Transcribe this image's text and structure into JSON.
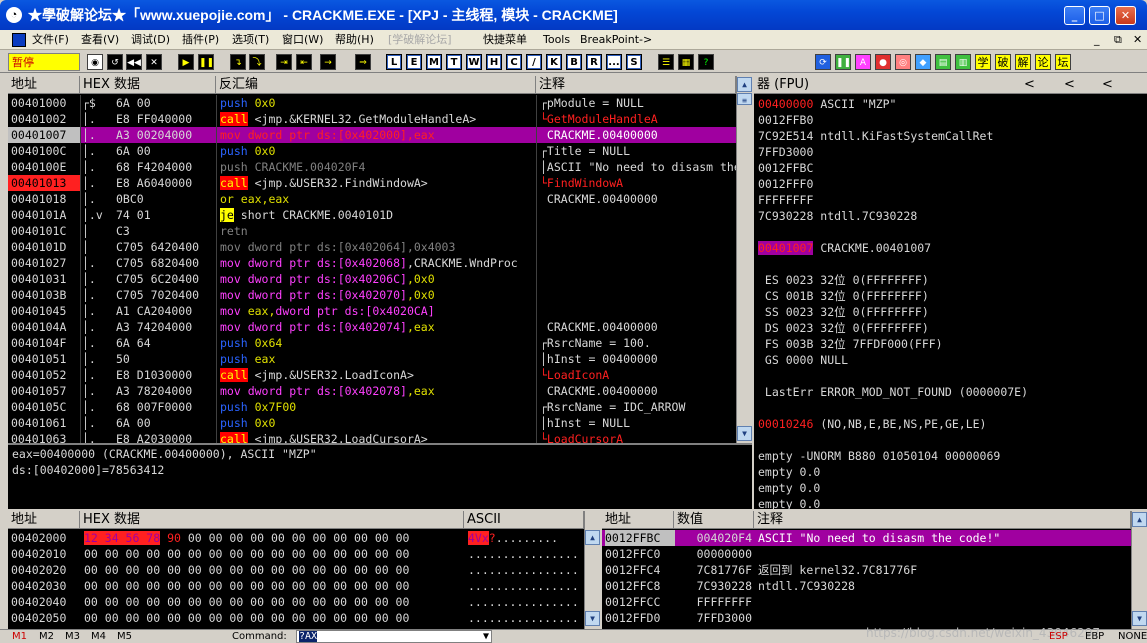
{
  "window": {
    "title": "★學破解论坛★「www.xuepojie.com」 - CRACKME.EXE - [XPJ - 主线程, 模块 - CRACKME]",
    "min": "_",
    "max": "□",
    "close": "✕"
  },
  "menu": {
    "items": [
      "文件(F)",
      "查看(V)",
      "调试(D)",
      "插件(P)",
      "选项(T)",
      "窗口(W)",
      "帮助(H)",
      "[学破解论坛]",
      "快捷菜单",
      "Tools",
      "BreakPoint->"
    ],
    "mdi": [
      "_",
      "⧉",
      "✕"
    ]
  },
  "toolbar": {
    "status": "暂停",
    "letters": [
      "L",
      "E",
      "M",
      "T",
      "W",
      "H",
      "C",
      "/",
      "K",
      "B",
      "R",
      "...",
      "S"
    ],
    "chinese": [
      "学",
      "破",
      "解",
      "论",
      "坛"
    ]
  },
  "disasm": {
    "headers": {
      "addr": "地址",
      "hex": "HEX 数据",
      "dis": "反汇编",
      "comment": "注释"
    },
    "rows": [
      {
        "addr": "00401000",
        "mark": "┌$",
        "hex": "6A 00",
        "dis": [
          [
            "push",
            "kw-push"
          ],
          [
            " 0x0",
            "y"
          ]
        ],
        "comment": "┌pModule = NULL",
        "cclass": "w"
      },
      {
        "addr": "00401002",
        "mark": "│.",
        "hex": "E8 FF040000",
        "dis": [
          [
            "call",
            "kw-call"
          ],
          [
            " <jmp.&KERNEL32.GetModuleHandleA>",
            "w"
          ]
        ],
        "comment": "└GetModuleHandleA",
        "cclass": "red"
      },
      {
        "addr": "00401007",
        "mark": "│.",
        "hex": "A3 00204000",
        "dis": [
          [
            "mov dword ptr ds:[0x402000],eax",
            "red"
          ]
        ],
        "comment": " CRACKME.00400000",
        "cclass": "w",
        "sel": true
      },
      {
        "addr": "0040100C",
        "mark": "│.",
        "hex": "6A 00",
        "dis": [
          [
            "push",
            "kw-push"
          ],
          [
            " 0x0",
            "y"
          ]
        ],
        "comment": "┌Title = NULL",
        "cclass": "w"
      },
      {
        "addr": "0040100E",
        "mark": "│.",
        "hex": "68 F4204000",
        "dis": [
          [
            "push CRACKME.004020F4",
            "gray"
          ]
        ],
        "comment": "│ASCII \"No need to disasm the code!\"",
        "cclass": "w"
      },
      {
        "addr": "00401013",
        "mark": "│.",
        "hex": "E8 A6040000",
        "dis": [
          [
            "call",
            "kw-call"
          ],
          [
            " <jmp.&USER32.FindWindowA>",
            "w"
          ]
        ],
        "comment": "└FindWindowA",
        "cclass": "red",
        "addrRed": true
      },
      {
        "addr": "00401018",
        "mark": "│.",
        "hex": "0BC0",
        "dis": [
          [
            "or eax,eax",
            "y"
          ]
        ],
        "comment": " CRACKME.00400000",
        "cclass": "w"
      },
      {
        "addr": "0040101A",
        "mark": "│.v",
        "hex": "74 01",
        "dis": [
          [
            "je",
            "kw-je"
          ],
          [
            " short CRACKME.0040101D",
            "w"
          ]
        ],
        "comment": "",
        "cclass": "w"
      },
      {
        "addr": "0040101C",
        "mark": "│",
        "hex": "C3",
        "dis": [
          [
            "retn",
            "gray"
          ]
        ],
        "comment": "",
        "cclass": "w"
      },
      {
        "addr": "0040101D",
        "mark": "│",
        "hex": "C705 6420400",
        "dis": [
          [
            "mov dword ptr ds:[0x402064],0x4003",
            "gray"
          ]
        ],
        "comment": "",
        "cclass": "w"
      },
      {
        "addr": "00401027",
        "mark": "│.",
        "hex": "C705 6820400",
        "dis": [
          [
            "mov",
            "kw-mov"
          ],
          [
            " dword ptr ds:[0x402068]",
            "mag"
          ],
          [
            ",CRACKME.WndProc",
            "w"
          ]
        ],
        "comment": "",
        "cclass": "w"
      },
      {
        "addr": "00401031",
        "mark": "│.",
        "hex": "C705 6C20400",
        "dis": [
          [
            "mov",
            "kw-mov"
          ],
          [
            " dword ptr ds:[0x40206C]",
            "mag"
          ],
          [
            ",0x0",
            "y"
          ]
        ],
        "comment": "",
        "cclass": "w"
      },
      {
        "addr": "0040103B",
        "mark": "│.",
        "hex": "C705 7020400",
        "dis": [
          [
            "mov",
            "kw-mov"
          ],
          [
            " dword ptr ds:[0x402070]",
            "mag"
          ],
          [
            ",0x0",
            "y"
          ]
        ],
        "comment": "",
        "cclass": "w"
      },
      {
        "addr": "00401045",
        "mark": "│.",
        "hex": "A1 CA204000",
        "dis": [
          [
            "mov",
            "kw-mov"
          ],
          [
            " eax,",
            "y"
          ],
          [
            "dword ptr ds:[0x4020CA]",
            "mag"
          ]
        ],
        "comment": "",
        "cclass": "w"
      },
      {
        "addr": "0040104A",
        "mark": "│.",
        "hex": "A3 74204000",
        "dis": [
          [
            "mov",
            "kw-mov"
          ],
          [
            " dword ptr ds:[0x402074]",
            "mag"
          ],
          [
            ",eax",
            "y"
          ]
        ],
        "comment": " CRACKME.00400000",
        "cclass": "w"
      },
      {
        "addr": "0040104F",
        "mark": "│.",
        "hex": "6A 64",
        "dis": [
          [
            "push",
            "kw-push"
          ],
          [
            " 0x64",
            "y"
          ]
        ],
        "comment": "┌RsrcName = 100.",
        "cclass": "w"
      },
      {
        "addr": "00401051",
        "mark": "│.",
        "hex": "50",
        "dis": [
          [
            "push",
            "kw-push"
          ],
          [
            " eax",
            "y"
          ]
        ],
        "comment": "│hInst = 00400000",
        "cclass": "w"
      },
      {
        "addr": "00401052",
        "mark": "│.",
        "hex": "E8 D1030000",
        "dis": [
          [
            "call",
            "kw-call"
          ],
          [
            " <jmp.&USER32.LoadIconA>",
            "w"
          ]
        ],
        "comment": "└LoadIconA",
        "cclass": "red"
      },
      {
        "addr": "00401057",
        "mark": "│.",
        "hex": "A3 78204000",
        "dis": [
          [
            "mov",
            "kw-mov"
          ],
          [
            " dword ptr ds:[0x402078]",
            "mag"
          ],
          [
            ",eax",
            "y"
          ]
        ],
        "comment": " CRACKME.00400000",
        "cclass": "w"
      },
      {
        "addr": "0040105C",
        "mark": "│.",
        "hex": "68 007F0000",
        "dis": [
          [
            "push",
            "kw-push"
          ],
          [
            " 0x7F00",
            "y"
          ]
        ],
        "comment": "┌RsrcName = IDC_ARROW",
        "cclass": "w"
      },
      {
        "addr": "00401061",
        "mark": "│.",
        "hex": "6A 00",
        "dis": [
          [
            "push",
            "kw-push"
          ],
          [
            " 0x0",
            "y"
          ]
        ],
        "comment": "│hInst = NULL",
        "cclass": "w"
      },
      {
        "addr": "00401063",
        "mark": "│.",
        "hex": "E8 A2030000",
        "dis": [
          [
            "call",
            "kw-call"
          ],
          [
            " <jmp.&USER32.LoadCursorA>",
            "w"
          ]
        ],
        "comment": "└LoadCursorA",
        "cclass": "red"
      }
    ],
    "info": [
      "eax=00400000 (CRACKME.00400000), ASCII \"MZP\"",
      "ds:[00402000]=78563412"
    ]
  },
  "registers": {
    "header": "器 (FPU)",
    "arrows": [
      "<",
      "<",
      "<"
    ],
    "lines": [
      {
        "t": "00400000 ASCII \"MZP\"",
        "c": "reghl"
      },
      {
        "t": "0012FFB0",
        "c": "w"
      },
      {
        "t": "7C92E514 ntdll.KiFastSystemCallRet",
        "c": "w"
      },
      {
        "t": "7FFD3000",
        "c": "w"
      },
      {
        "t": "0012FFBC",
        "c": "w"
      },
      {
        "t": "0012FFF0",
        "c": "w"
      },
      {
        "t": "FFFFFFFF",
        "c": "w"
      },
      {
        "t": "7C930228 ntdll.7C930228",
        "c": "w"
      },
      {
        "t": "",
        "c": "w"
      },
      {
        "t": "00401007 CRACKME.00401007",
        "c": "eip"
      },
      {
        "t": "",
        "c": "w"
      },
      {
        "t": " ES 0023 32位 0(FFFFFFFF)",
        "c": "w"
      },
      {
        "t": " CS 001B 32位 0(FFFFFFFF)",
        "c": "w"
      },
      {
        "t": " SS 0023 32位 0(FFFFFFFF)",
        "c": "w"
      },
      {
        "t": " DS 0023 32位 0(FFFFFFFF)",
        "c": "w"
      },
      {
        "t": " FS 003B 32位 7FFDF000(FFF)",
        "c": "w"
      },
      {
        "t": " GS 0000 NULL",
        "c": "w"
      },
      {
        "t": "",
        "c": "w"
      },
      {
        "t": " LastErr ERROR_MOD_NOT_FOUND (0000007E)",
        "c": "w"
      },
      {
        "t": "",
        "c": "w"
      },
      {
        "t": "00010246 (NO,NB,E,BE,NS,PE,GE,LE)",
        "c": "efl"
      },
      {
        "t": "",
        "c": "w"
      },
      {
        "t": "empty -UNORM B880 01050104 00000069",
        "c": "w"
      },
      {
        "t": "empty 0.0",
        "c": "w"
      },
      {
        "t": "empty 0.0",
        "c": "w"
      },
      {
        "t": "empty 0.0",
        "c": "w"
      },
      {
        "t": "empty 0.0",
        "c": "w"
      },
      {
        "t": "empty 0.0",
        "c": "w"
      }
    ]
  },
  "dump": {
    "headers": {
      "addr": "地址",
      "hex": "HEX 数据",
      "ascii": "ASCII"
    },
    "rows": [
      {
        "addr": "00402000",
        "hex": "12 34 56 78 90 00 00 00 00 00 00 00 00 00 00 00",
        "ascii": "4Vx?.........",
        "hl": true
      },
      {
        "addr": "00402010",
        "hex": "00 00 00 00 00 00 00 00 00 00 00 00 00 00 00 00",
        "ascii": "................"
      },
      {
        "addr": "00402020",
        "hex": "00 00 00 00 00 00 00 00 00 00 00 00 00 00 00 00",
        "ascii": "................"
      },
      {
        "addr": "00402030",
        "hex": "00 00 00 00 00 00 00 00 00 00 00 00 00 00 00 00",
        "ascii": "................"
      },
      {
        "addr": "00402040",
        "hex": "00 00 00 00 00 00 00 00 00 00 00 00 00 00 00 00",
        "ascii": "................"
      },
      {
        "addr": "00402050",
        "hex": "00 00 00 00 00 00 00 00 00 00 00 00 00 00 00 00",
        "ascii": "................"
      }
    ]
  },
  "stack": {
    "headers": {
      "addr": "地址",
      "val": "数值",
      "comment": "注释"
    },
    "rows": [
      {
        "addr": "0012FFBC",
        "val": "004020F4",
        "comment": "ASCII \"No need to disasm the code!\"",
        "sel": true
      },
      {
        "addr": "0012FFC0",
        "val": "00000000",
        "comment": ""
      },
      {
        "addr": "0012FFC4",
        "val": "7C81776F",
        "comment": "返回到 kernel32.7C81776F"
      },
      {
        "addr": "0012FFC8",
        "val": "7C930228",
        "comment": "ntdll.7C930228"
      },
      {
        "addr": "0012FFCC",
        "val": "FFFFFFFF",
        "comment": ""
      },
      {
        "addr": "0012FFD0",
        "val": "7FFD3000",
        "comment": ""
      }
    ]
  },
  "statusbar": {
    "tabs": [
      "M1",
      "M2",
      "M3",
      "M4",
      "M5"
    ],
    "command_label": "Command:",
    "command_value": "?AX",
    "right": [
      "ESP",
      "EBP",
      "NONE"
    ],
    "watermark": "https://blog.csdn.net/weixin_43046297"
  }
}
